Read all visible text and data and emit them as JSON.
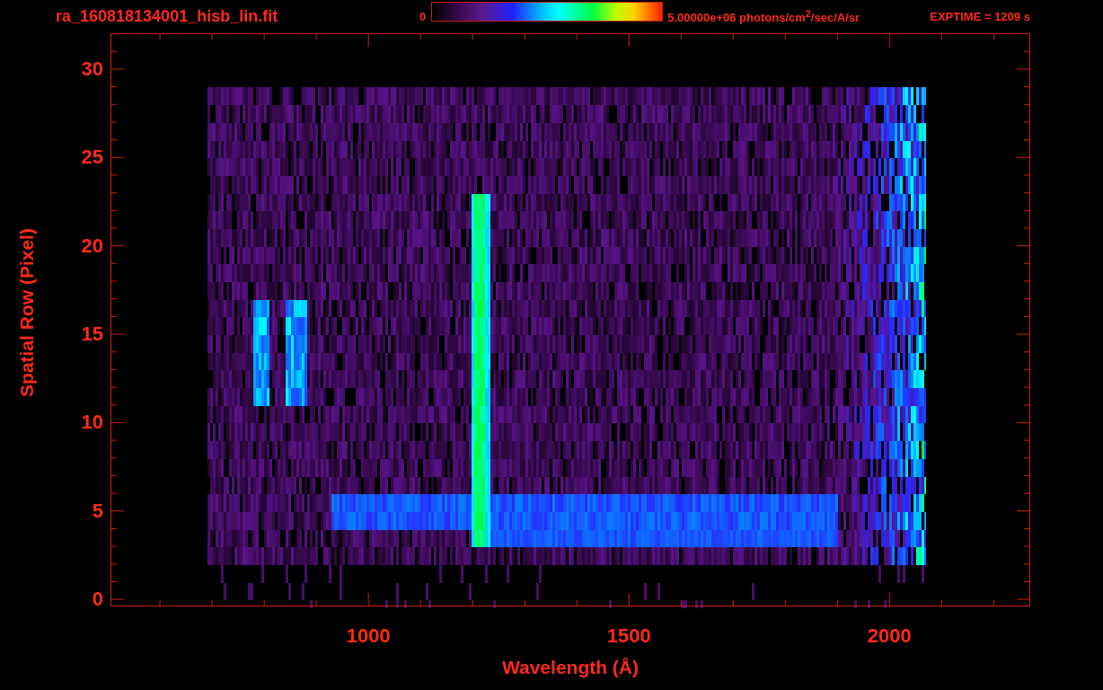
{
  "header": {
    "filename": "ra_160818134001_hisb_lin.fit",
    "colorbar": {
      "min_label": "0",
      "max_label": "5.00000e+06 photons/cm$^{2}$/sec/A/sr"
    },
    "exposure": "EXPTIME = 1209 s"
  },
  "plot": {
    "ylabel": "Spatial Row (Pixel)",
    "xlabel": "Wavelength (Å)",
    "yticks": [
      "30",
      "25",
      "20",
      "15",
      "10",
      "5",
      "0"
    ],
    "xticks": [
      "1000",
      "1500",
      "2000"
    ]
  }
}
